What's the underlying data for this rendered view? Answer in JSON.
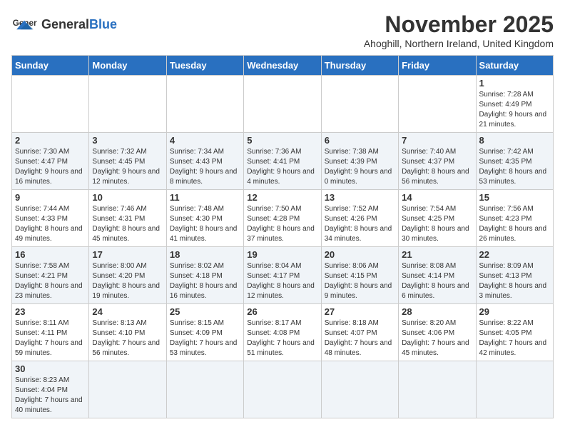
{
  "logo": {
    "general": "General",
    "blue": "Blue"
  },
  "title": "November 2025",
  "subtitle": "Ahoghill, Northern Ireland, United Kingdom",
  "days_of_week": [
    "Sunday",
    "Monday",
    "Tuesday",
    "Wednesday",
    "Thursday",
    "Friday",
    "Saturday"
  ],
  "weeks": [
    [
      {
        "day": "",
        "info": ""
      },
      {
        "day": "",
        "info": ""
      },
      {
        "day": "",
        "info": ""
      },
      {
        "day": "",
        "info": ""
      },
      {
        "day": "",
        "info": ""
      },
      {
        "day": "",
        "info": ""
      },
      {
        "day": "1",
        "info": "Sunrise: 7:28 AM\nSunset: 4:49 PM\nDaylight: 9 hours and 21 minutes."
      }
    ],
    [
      {
        "day": "2",
        "info": "Sunrise: 7:30 AM\nSunset: 4:47 PM\nDaylight: 9 hours and 16 minutes."
      },
      {
        "day": "3",
        "info": "Sunrise: 7:32 AM\nSunset: 4:45 PM\nDaylight: 9 hours and 12 minutes."
      },
      {
        "day": "4",
        "info": "Sunrise: 7:34 AM\nSunset: 4:43 PM\nDaylight: 9 hours and 8 minutes."
      },
      {
        "day": "5",
        "info": "Sunrise: 7:36 AM\nSunset: 4:41 PM\nDaylight: 9 hours and 4 minutes."
      },
      {
        "day": "6",
        "info": "Sunrise: 7:38 AM\nSunset: 4:39 PM\nDaylight: 9 hours and 0 minutes."
      },
      {
        "day": "7",
        "info": "Sunrise: 7:40 AM\nSunset: 4:37 PM\nDaylight: 8 hours and 56 minutes."
      },
      {
        "day": "8",
        "info": "Sunrise: 7:42 AM\nSunset: 4:35 PM\nDaylight: 8 hours and 53 minutes."
      }
    ],
    [
      {
        "day": "9",
        "info": "Sunrise: 7:44 AM\nSunset: 4:33 PM\nDaylight: 8 hours and 49 minutes."
      },
      {
        "day": "10",
        "info": "Sunrise: 7:46 AM\nSunset: 4:31 PM\nDaylight: 8 hours and 45 minutes."
      },
      {
        "day": "11",
        "info": "Sunrise: 7:48 AM\nSunset: 4:30 PM\nDaylight: 8 hours and 41 minutes."
      },
      {
        "day": "12",
        "info": "Sunrise: 7:50 AM\nSunset: 4:28 PM\nDaylight: 8 hours and 37 minutes."
      },
      {
        "day": "13",
        "info": "Sunrise: 7:52 AM\nSunset: 4:26 PM\nDaylight: 8 hours and 34 minutes."
      },
      {
        "day": "14",
        "info": "Sunrise: 7:54 AM\nSunset: 4:25 PM\nDaylight: 8 hours and 30 minutes."
      },
      {
        "day": "15",
        "info": "Sunrise: 7:56 AM\nSunset: 4:23 PM\nDaylight: 8 hours and 26 minutes."
      }
    ],
    [
      {
        "day": "16",
        "info": "Sunrise: 7:58 AM\nSunset: 4:21 PM\nDaylight: 8 hours and 23 minutes."
      },
      {
        "day": "17",
        "info": "Sunrise: 8:00 AM\nSunset: 4:20 PM\nDaylight: 8 hours and 19 minutes."
      },
      {
        "day": "18",
        "info": "Sunrise: 8:02 AM\nSunset: 4:18 PM\nDaylight: 8 hours and 16 minutes."
      },
      {
        "day": "19",
        "info": "Sunrise: 8:04 AM\nSunset: 4:17 PM\nDaylight: 8 hours and 12 minutes."
      },
      {
        "day": "20",
        "info": "Sunrise: 8:06 AM\nSunset: 4:15 PM\nDaylight: 8 hours and 9 minutes."
      },
      {
        "day": "21",
        "info": "Sunrise: 8:08 AM\nSunset: 4:14 PM\nDaylight: 8 hours and 6 minutes."
      },
      {
        "day": "22",
        "info": "Sunrise: 8:09 AM\nSunset: 4:13 PM\nDaylight: 8 hours and 3 minutes."
      }
    ],
    [
      {
        "day": "23",
        "info": "Sunrise: 8:11 AM\nSunset: 4:11 PM\nDaylight: 7 hours and 59 minutes."
      },
      {
        "day": "24",
        "info": "Sunrise: 8:13 AM\nSunset: 4:10 PM\nDaylight: 7 hours and 56 minutes."
      },
      {
        "day": "25",
        "info": "Sunrise: 8:15 AM\nSunset: 4:09 PM\nDaylight: 7 hours and 53 minutes."
      },
      {
        "day": "26",
        "info": "Sunrise: 8:17 AM\nSunset: 4:08 PM\nDaylight: 7 hours and 51 minutes."
      },
      {
        "day": "27",
        "info": "Sunrise: 8:18 AM\nSunset: 4:07 PM\nDaylight: 7 hours and 48 minutes."
      },
      {
        "day": "28",
        "info": "Sunrise: 8:20 AM\nSunset: 4:06 PM\nDaylight: 7 hours and 45 minutes."
      },
      {
        "day": "29",
        "info": "Sunrise: 8:22 AM\nSunset: 4:05 PM\nDaylight: 7 hours and 42 minutes."
      }
    ],
    [
      {
        "day": "30",
        "info": "Sunrise: 8:23 AM\nSunset: 4:04 PM\nDaylight: 7 hours and 40 minutes."
      },
      {
        "day": "",
        "info": ""
      },
      {
        "day": "",
        "info": ""
      },
      {
        "day": "",
        "info": ""
      },
      {
        "day": "",
        "info": ""
      },
      {
        "day": "",
        "info": ""
      },
      {
        "day": "",
        "info": ""
      }
    ]
  ]
}
